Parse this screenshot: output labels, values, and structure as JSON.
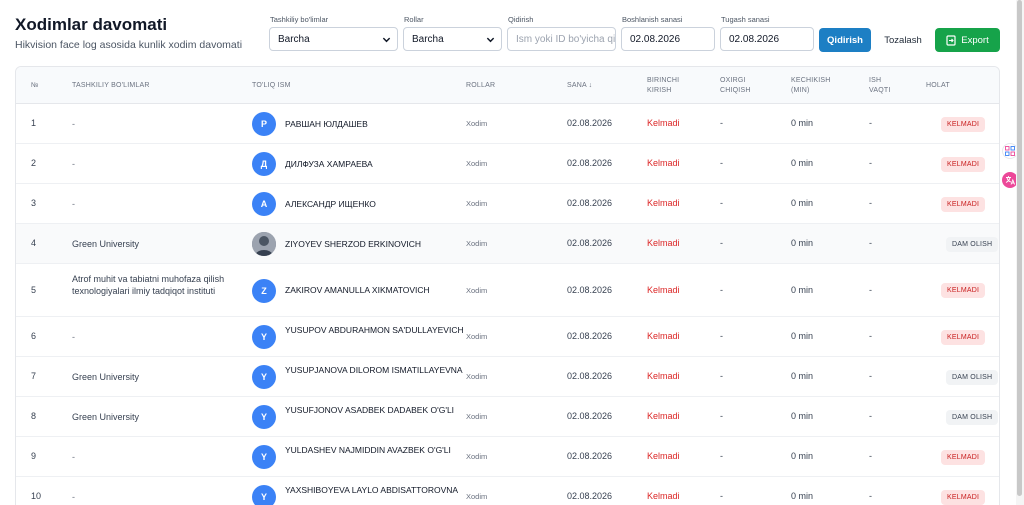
{
  "header": {
    "title": "Xodimlar davomati",
    "subtitle": "Hikvision face log asosida kunlik xodim davomati"
  },
  "filters": {
    "department_label": "Tashkiliy bo'limlar",
    "department_value": "Barcha",
    "roles_label": "Rollar",
    "roles_value": "Barcha",
    "search_label": "Qidirish",
    "search_placeholder": "Ism yoki ID bo'yicha qid",
    "start_label": "Boshlanish sanasi",
    "start_value": "02.08.2026",
    "end_label": "Tugash sanasi",
    "end_value": "02.08.2026",
    "search_button": "Qidirish",
    "clear_button": "Tozalash",
    "export_button": "Export"
  },
  "table": {
    "columns": {
      "num": "№",
      "dept": "TASHKILIY BO'LIMLAR",
      "name": "TO'LIQ ISM",
      "role": "ROLLAR",
      "date": "SANA ↓",
      "first_in_1": "BIRINCHI",
      "first_in_2": "KIRISH",
      "last_out_1": "OXIRGI",
      "last_out_2": "CHIQISH",
      "late_1": "KECHIKISH",
      "late_2": "(MIN)",
      "work_1": "ISH",
      "work_2": "VAQTI",
      "status": "HOLAT"
    },
    "rows": [
      {
        "num": "1",
        "dept": "-",
        "initial": "Р",
        "name": "РАВШАН ЮЛДАШЕВ",
        "role": "Xodim",
        "date": "02.08.2026",
        "first_in": "Kelmadi",
        "last_out": "-",
        "late": "0 min",
        "work": "-",
        "status": "KELMADI",
        "status_type": "absent"
      },
      {
        "num": "2",
        "dept": "-",
        "initial": "Д",
        "name": "ДИЛФУЗА ХАМРАЕВА",
        "role": "Xodim",
        "date": "02.08.2026",
        "first_in": "Kelmadi",
        "last_out": "-",
        "late": "0 min",
        "work": "-",
        "status": "KELMADI",
        "status_type": "absent"
      },
      {
        "num": "3",
        "dept": "-",
        "initial": "А",
        "name": "АЛЕКСАНДР ИЩЕНКО",
        "role": "Xodim",
        "date": "02.08.2026",
        "first_in": "Kelmadi",
        "last_out": "-",
        "late": "0 min",
        "work": "-",
        "status": "KELMADI",
        "status_type": "absent"
      },
      {
        "num": "4",
        "dept": "Green University",
        "initial": "",
        "name": "ZIYOYEV SHERZOD ERKINOVICH",
        "role": "Xodim",
        "date": "02.08.2026",
        "first_in": "Kelmadi",
        "last_out": "-",
        "late": "0 min",
        "work": "-",
        "status": "DAM OLISH",
        "status_type": "off"
      },
      {
        "num": "5",
        "dept": "Atrof muhit va tabiatni muhofaza qilish texnologiyalari ilmiy tadqiqot instituti",
        "initial": "Z",
        "name": "ZAKIROV AMANULLA XIKMATOVICH",
        "role": "Xodim",
        "date": "02.08.2026",
        "first_in": "Kelmadi",
        "last_out": "-",
        "late": "0 min",
        "work": "-",
        "status": "KELMADI",
        "status_type": "absent"
      },
      {
        "num": "6",
        "dept": "-",
        "initial": "Y",
        "name": "YUSUPOV ABDURAHMON SA'DULLAYEVICH",
        "role": "Xodim",
        "date": "02.08.2026",
        "first_in": "Kelmadi",
        "last_out": "-",
        "late": "0 min",
        "work": "-",
        "status": "KELMADI",
        "status_type": "absent"
      },
      {
        "num": "7",
        "dept": "Green University",
        "initial": "Y",
        "name": "YUSUPJANOVA DILOROM ISMATILLAYEVNA",
        "role": "Xodim",
        "date": "02.08.2026",
        "first_in": "Kelmadi",
        "last_out": "-",
        "late": "0 min",
        "work": "-",
        "status": "DAM OLISH",
        "status_type": "off"
      },
      {
        "num": "8",
        "dept": "Green University",
        "initial": "Y",
        "name": "YUSUFJONOV ASADBEK DADABEK O'G'LI",
        "role": "Xodim",
        "date": "02.08.2026",
        "first_in": "Kelmadi",
        "last_out": "-",
        "late": "0 min",
        "work": "-",
        "status": "DAM OLISH",
        "status_type": "off"
      },
      {
        "num": "9",
        "dept": "-",
        "initial": "Y",
        "name": "YULDASHEV NAJMIDDIN AVAZBEK O'G'LI",
        "role": "Xodim",
        "date": "02.08.2026",
        "first_in": "Kelmadi",
        "last_out": "-",
        "late": "0 min",
        "work": "-",
        "status": "KELMADI",
        "status_type": "absent"
      },
      {
        "num": "10",
        "dept": "-",
        "initial": "Y",
        "name": "YAXSHIBOYEVA LAYLO ABDISATTOROVNA",
        "role": "Xodim",
        "date": "02.08.2026",
        "first_in": "Kelmadi",
        "last_out": "-",
        "late": "0 min",
        "work": "-",
        "status": "KELMADI",
        "status_type": "absent"
      }
    ]
  },
  "colors": {
    "primary": "#1d7fc4",
    "export": "#16a34a",
    "absent_text": "#dc2626",
    "avatar": "#3b82f6"
  }
}
